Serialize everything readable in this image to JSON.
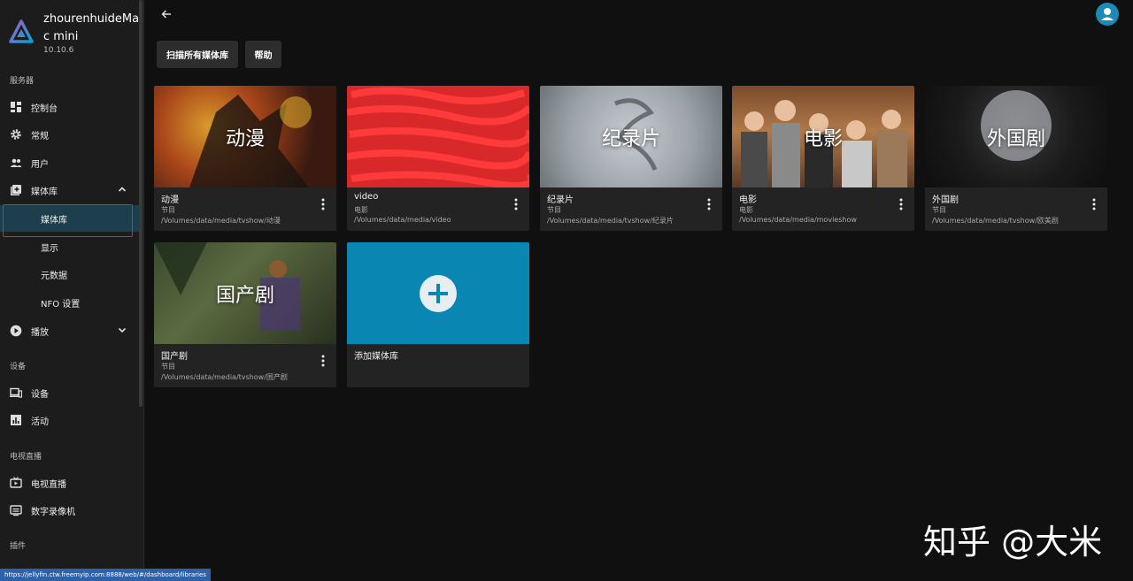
{
  "server": {
    "name": "zhourenhuideMac mini",
    "version": "10.10.6"
  },
  "sidebar": {
    "sections": {
      "server": "服务器",
      "devices": "设备",
      "livetv": "电视直播",
      "plugins": "插件"
    },
    "items": {
      "dashboard": "控制台",
      "general": "常规",
      "users": "用户",
      "libraries": "媒体库",
      "libraries_sub": "媒体库",
      "display": "显示",
      "metadata": "元数据",
      "nfo": "NFO 设置",
      "playback": "播放",
      "devices": "设备",
      "activity": "活动",
      "livetv": "电视直播",
      "dvr": "数字录像机"
    }
  },
  "toolbar": {
    "scan_label": "扫描所有媒体库",
    "help_label": "帮助"
  },
  "libraries": [
    {
      "title": "动漫",
      "name": "动漫",
      "type": "节目",
      "path": "/Volumes/data/media/tvshow/动漫"
    },
    {
      "title": "",
      "name": "video",
      "type": "电影",
      "path": "/Volumes/data/media/video"
    },
    {
      "title": "纪录片",
      "name": "纪录片",
      "type": "节目",
      "path": "/Volumes/data/media/tvshow/纪录片"
    },
    {
      "title": "电影",
      "name": "电影",
      "type": "电影",
      "path": "/Volumes/data/media/movieshow"
    },
    {
      "title": "外国剧",
      "name": "外国剧",
      "type": "节目",
      "path": "/Volumes/data/media/tvshow/欧美剧"
    },
    {
      "title": "国产剧",
      "name": "国产剧",
      "type": "节目",
      "path": "/Volumes/data/media/tvshow/国产剧"
    }
  ],
  "add_library": {
    "label": "添加媒体库"
  },
  "status_url": "https://jellyfin.ctw.freemyip.com:8888/web/#/dashboard/libraries",
  "watermark": "知乎 @大米",
  "colors": {
    "accent": "#00a4dc",
    "active_nav": "#1d3e4d",
    "add_card": "#0a86b3",
    "highlight_box": "#e0262e"
  }
}
